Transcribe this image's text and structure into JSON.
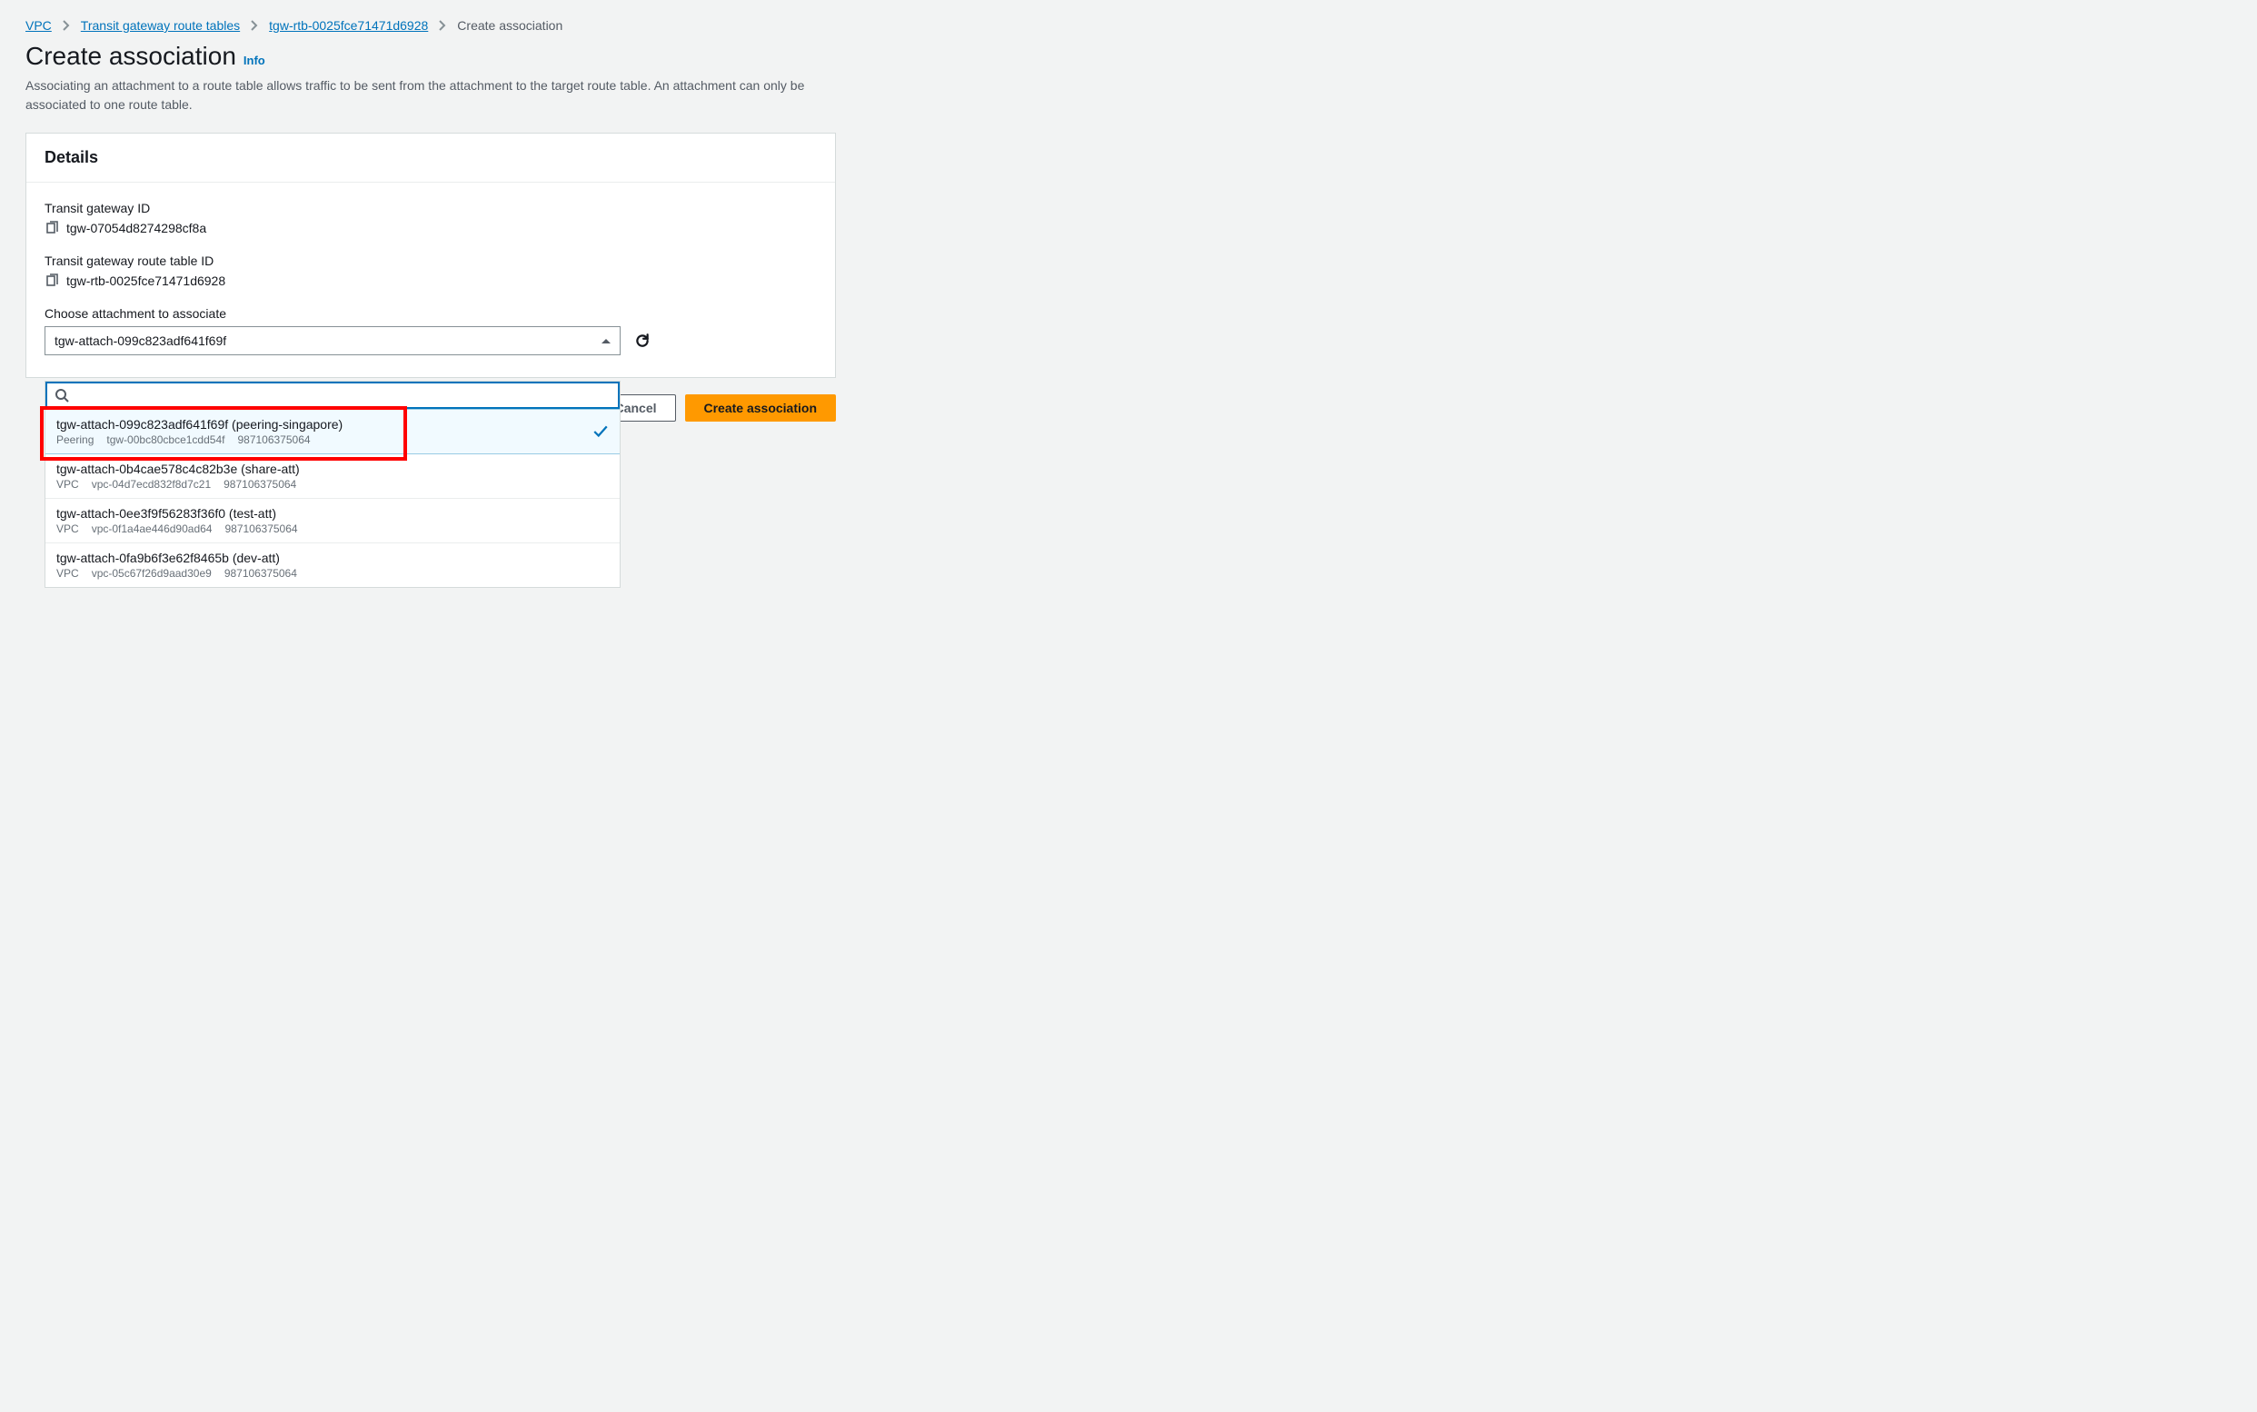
{
  "breadcrumb": {
    "items": [
      {
        "label": "VPC",
        "link": true
      },
      {
        "label": "Transit gateway route tables",
        "link": true
      },
      {
        "label": "tgw-rtb-0025fce71471d6928",
        "link": true
      },
      {
        "label": "Create association",
        "link": false
      }
    ]
  },
  "header": {
    "title": "Create association",
    "info": "Info",
    "description": "Associating an attachment to a route table allows traffic to be sent from the attachment to the target route table. An attachment can only be associated to one route table."
  },
  "panel": {
    "title": "Details",
    "fields": {
      "tgw_id_label": "Transit gateway ID",
      "tgw_id_value": "tgw-07054d8274298cf8a",
      "rtb_id_label": "Transit gateway route table ID",
      "rtb_id_value": "tgw-rtb-0025fce71471d6928",
      "attach_label": "Choose attachment to associate",
      "attach_selected": "tgw-attach-099c823adf641f69f"
    }
  },
  "dropdown": {
    "search_value": "",
    "items": [
      {
        "title": "tgw-attach-099c823adf641f69f (peering-singapore)",
        "type": "Peering",
        "resource": "tgw-00bc80cbce1cdd54f",
        "account": "987106375064",
        "selected": true
      },
      {
        "title": "tgw-attach-0b4cae578c4c82b3e (share-att)",
        "type": "VPC",
        "resource": "vpc-04d7ecd832f8d7c21",
        "account": "987106375064",
        "selected": false
      },
      {
        "title": "tgw-attach-0ee3f9f56283f36f0 (test-att)",
        "type": "VPC",
        "resource": "vpc-0f1a4ae446d90ad64",
        "account": "987106375064",
        "selected": false
      },
      {
        "title": "tgw-attach-0fa9b6f3e62f8465b (dev-att)",
        "type": "VPC",
        "resource": "vpc-05c67f26d9aad30e9",
        "account": "987106375064",
        "selected": false
      }
    ]
  },
  "footer": {
    "cancel": "Cancel",
    "submit": "Create association"
  }
}
